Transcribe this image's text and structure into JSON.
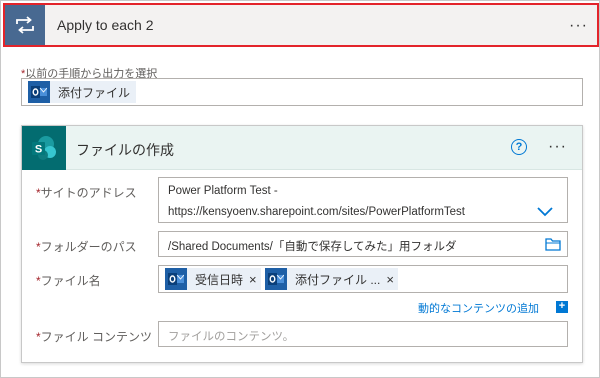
{
  "loop": {
    "title": "Apply to each 2",
    "prev_output_label": "以前の手順から出力を選択",
    "prev_output_token": "添付ファイル"
  },
  "action": {
    "title": "ファイルの作成",
    "fields": {
      "site_label": "サイトのアドレス",
      "site_value_line1": "Power Platform Test -",
      "site_value_line2": "https://kensyoenv.sharepoint.com/sites/PowerPlatformTest",
      "folder_label": "フォルダーのパス",
      "folder_value": "/Shared Documents/「自動で保存してみた」用フォルダ",
      "filename_label": "ファイル名",
      "filename_token1": "受信日時",
      "filename_token2": "添付ファイル ...",
      "dynamic_content_link": "動的なコンテンツの追加",
      "content_label": "ファイル コンテンツ",
      "content_placeholder": "ファイルのコンテンツ。"
    }
  },
  "common": {
    "required_mark": "*",
    "ellipsis": "···",
    "help_glyph": "?",
    "remove_glyph": "×",
    "plus_glyph": "+"
  },
  "icons": [
    "loop-icon",
    "outlook-icon",
    "sharepoint-icon",
    "help-icon",
    "more-icon",
    "chevron-down-icon",
    "folder-icon",
    "plus-icon"
  ],
  "colors": {
    "accent_red": "#e3242b",
    "loop_blue": "#486991",
    "sharepoint_teal": "#036c70",
    "outlook_blue": "#1e5fa6",
    "link_blue": "#0078d4"
  }
}
